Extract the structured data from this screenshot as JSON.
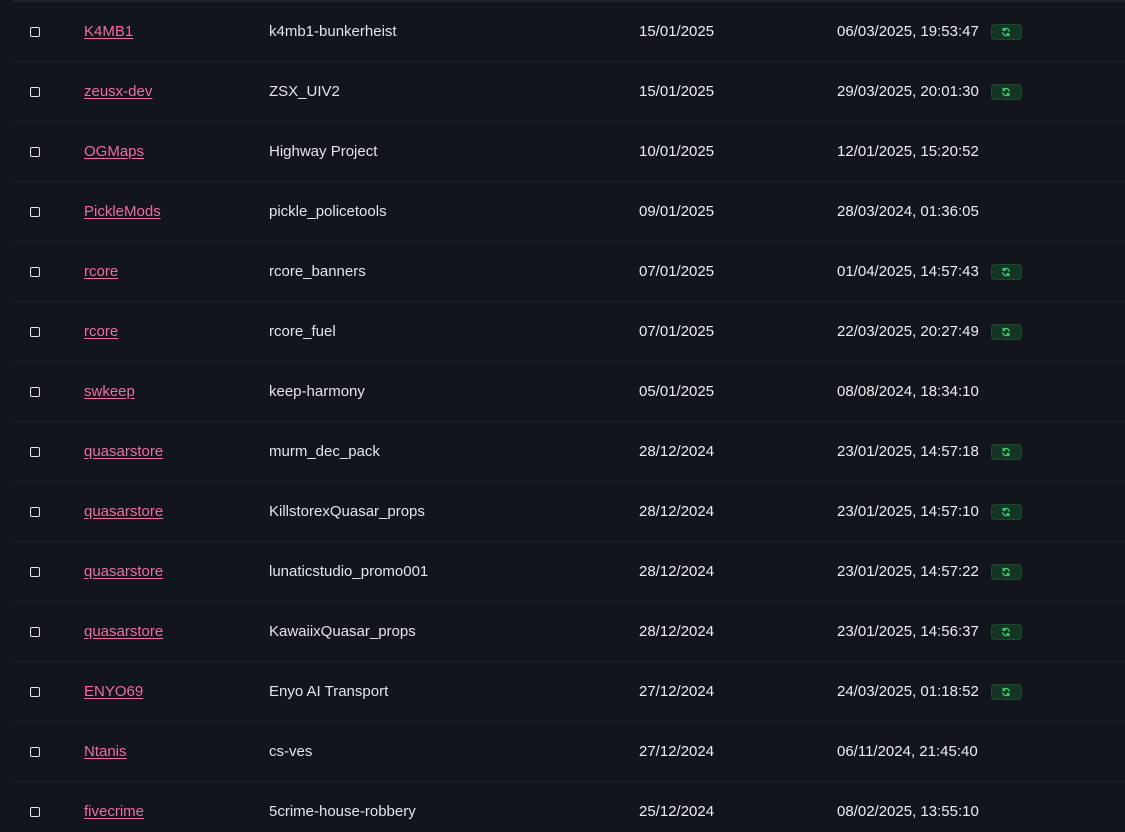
{
  "colors": {
    "background": "#12151c",
    "author_link": "#f16aa6",
    "sync_badge_bg": "#153524",
    "sync_icon": "#3ecf6b"
  },
  "rows": [
    {
      "author": "K4MB1",
      "resource": "k4mb1-bunkerheist",
      "date": "15/01/2025",
      "updated": "06/03/2025, 19:53:47",
      "synced": true,
      "sync_icon": "refresh-icon"
    },
    {
      "author": "zeusx-dev",
      "resource": "ZSX_UIV2",
      "date": "15/01/2025",
      "updated": "29/03/2025, 20:01:30",
      "synced": true,
      "sync_icon": "refresh-icon"
    },
    {
      "author": "OGMaps",
      "resource": "Highway Project",
      "date": "10/01/2025",
      "updated": "12/01/2025, 15:20:52",
      "synced": false
    },
    {
      "author": "PickleMods",
      "resource": "pickle_policetools",
      "date": "09/01/2025",
      "updated": "28/03/2024, 01:36:05",
      "synced": false
    },
    {
      "author": "rcore",
      "resource": "rcore_banners",
      "date": "07/01/2025",
      "updated": "01/04/2025, 14:57:43",
      "synced": true,
      "sync_icon": "refresh-icon"
    },
    {
      "author": "rcore",
      "resource": "rcore_fuel",
      "date": "07/01/2025",
      "updated": "22/03/2025, 20:27:49",
      "synced": true,
      "sync_icon": "refresh-icon"
    },
    {
      "author": "swkeep",
      "resource": "keep-harmony",
      "date": "05/01/2025",
      "updated": "08/08/2024, 18:34:10",
      "synced": false
    },
    {
      "author": "quasarstore",
      "resource": "murm_dec_pack",
      "date": "28/12/2024",
      "updated": "23/01/2025, 14:57:18",
      "synced": true,
      "sync_icon": "refresh-icon"
    },
    {
      "author": "quasarstore",
      "resource": "KillstorexQuasar_props",
      "date": "28/12/2024",
      "updated": "23/01/2025, 14:57:10",
      "synced": true,
      "sync_icon": "refresh-icon"
    },
    {
      "author": "quasarstore",
      "resource": "lunaticstudio_promo001",
      "date": "28/12/2024",
      "updated": "23/01/2025, 14:57:22",
      "synced": true,
      "sync_icon": "refresh-icon"
    },
    {
      "author": "quasarstore",
      "resource": "KawaiixQuasar_props",
      "date": "28/12/2024",
      "updated": "23/01/2025, 14:56:37",
      "synced": true,
      "sync_icon": "refresh-icon"
    },
    {
      "author": "ENYO69",
      "resource": "Enyo AI Transport",
      "date": "27/12/2024",
      "updated": "24/03/2025, 01:18:52",
      "synced": true,
      "sync_icon": "refresh-icon"
    },
    {
      "author": "Ntanis",
      "resource": "cs-ves",
      "date": "27/12/2024",
      "updated": "06/11/2024, 21:45:40",
      "synced": false
    },
    {
      "author": "fivecrime",
      "resource": "5crime-house-robbery",
      "date": "25/12/2024",
      "updated": "08/02/2025, 13:55:10",
      "synced": false
    }
  ]
}
